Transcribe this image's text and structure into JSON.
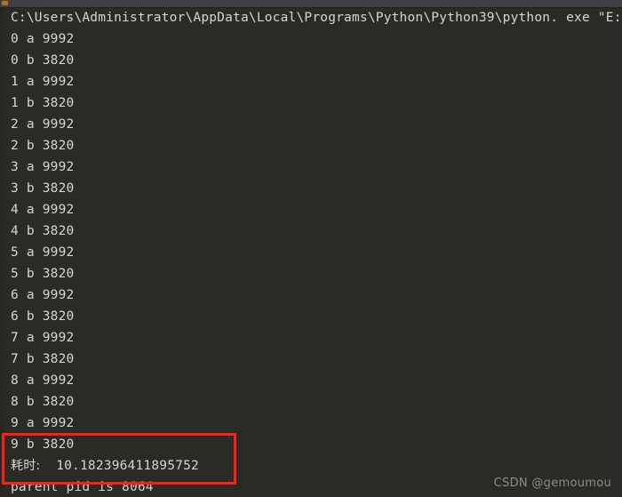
{
  "window": {
    "title": "Python console output",
    "background_color": "#2b2b26",
    "text_color": "#d6d6cf",
    "toolbar_color": "#3c4043",
    "highlight_color": "#ff1f10"
  },
  "console": {
    "command_line": "C:\\Users\\Administrator\\AppData\\Local\\Programs\\Python\\Python39\\python. exe \"E:/py/python",
    "output_lines": [
      "0 a 9992",
      "0 b 3820",
      "1 a 9992",
      "1 b 3820",
      "2 a 9992",
      "2 b 3820",
      "3 a 9992",
      "3 b 3820",
      "4 a 9992",
      "4 b 3820",
      "5 a 9992",
      "5 b 3820",
      "6 a 9992",
      "6 b 3820",
      "7 a 9992",
      "7 b 3820",
      "8 a 9992",
      "8 b 3820",
      "9 a 9992",
      "9 b 3820"
    ],
    "elapsed_label": "耗时:",
    "elapsed_value": "10.182396411895752",
    "parent_pid_line": "parent pid is 8064"
  },
  "watermark": {
    "text": "CSDN @gemoumou"
  }
}
